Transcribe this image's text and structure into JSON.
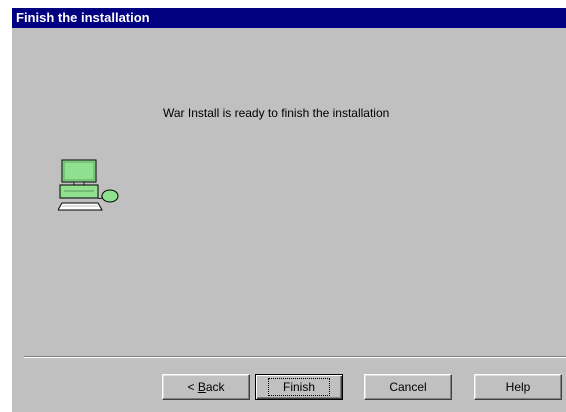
{
  "window": {
    "title": "Finish the installation"
  },
  "message": "War Install is ready to finish the installation",
  "icon": "computer-icon",
  "buttons": {
    "back": {
      "prefix": "< ",
      "accel": "B",
      "rest": "ack"
    },
    "finish": "Finish",
    "cancel": "Cancel",
    "help": "Help"
  },
  "colors": {
    "titlebar": "#000080",
    "dialog_bg": "#c0c0c0",
    "icon_green": "#8fe08f"
  }
}
